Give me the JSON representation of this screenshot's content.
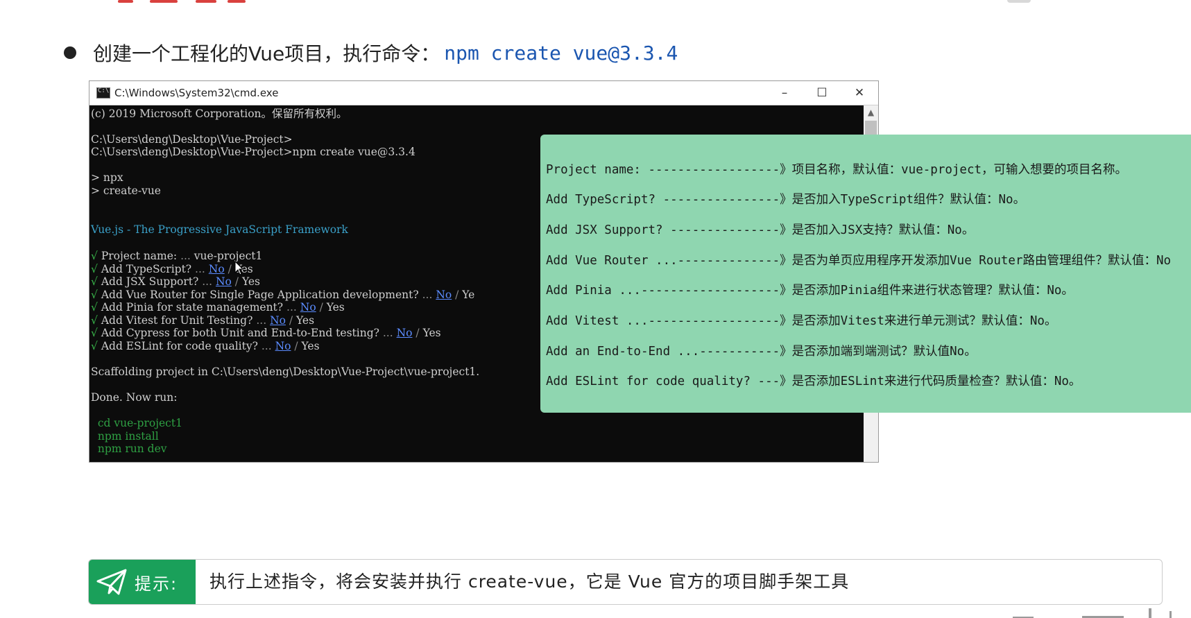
{
  "slide": {
    "bullet_text": "创建一个工程化的Vue项目，执行命令：",
    "bullet_command": "npm create vue@3.3.4"
  },
  "cmd_window": {
    "title": "C:\\Windows\\System32\\cmd.exe",
    "minimize_glyph": "–",
    "maximize_glyph": "☐",
    "close_glyph": "✕",
    "scroll_up_glyph": "▲"
  },
  "terminal": {
    "copyright": "(c) 2019 Microsoft Corporation。保留所有权利。",
    "prompt1": "C:\\Users\\deng\\Desktop\\Vue-Project>",
    "prompt2": "C:\\Users\\deng\\Desktop\\Vue-Project>npm create vue@3.3.4",
    "npx": "> npx",
    "create_vue": "> create-vue",
    "banner": "Vue.js - The Progressive JavaScript Framework",
    "check_mark": "√",
    "ellipsis": " ... ",
    "no": "No",
    "slash": " / ",
    "yes": "Yes",
    "q_project_name": "Project name:",
    "a_project_name": "vue-project1",
    "q_typescript": "Add TypeScript?",
    "q_jsx": "Add JSX Support?",
    "q_router": "Add Vue Router for Single Page Application development?",
    "router_yes_partial": "Ye",
    "q_pinia": "Add Pinia for state management?",
    "q_vitest": "Add Vitest for Unit Testing?",
    "q_cypress": "Add Cypress for both Unit and End-to-End testing?",
    "q_eslint": "Add ESLint for code quality?",
    "scaffolding": "Scaffolding project in C:\\Users\\deng\\Desktop\\Vue-Project\\vue-project1.",
    "done": "Done. Now run:",
    "cmd_cd": "  cd vue-project1",
    "cmd_install": "  npm install",
    "cmd_dev": "  npm run dev"
  },
  "explanations": [
    "Project name: ------------------》项目名称，默认值：vue-project，可输入想要的项目名称。",
    "Add TypeScript? ----------------》是否加入TypeScript组件？默认值：No。",
    "Add JSX Support? ---------------》是否加入JSX支持？默认值：No。",
    "Add Vue Router ...--------------》是否为单页应用程序开发添加Vue Router路由管理组件？默认值：No",
    "Add Pinia ...-------------------》是否添加Pinia组件来进行状态管理？默认值：No。",
    "Add Vitest ...------------------》是否添加Vitest来进行单元测试？默认值：No。",
    "Add an End-to-End ...-----------》是否添加端到端测试？默认值No。",
    "Add ESLint for code quality? ---》是否添加ESLint来进行代码质量检查？默认值：No。"
  ],
  "tip": {
    "label": "提示:",
    "text": "执行上述指令，将会安装并执行 create-vue，它是 Vue 官方的项目脚手架工具"
  },
  "colors": {
    "accent_red": "#d9413e",
    "command_blue": "#1b56b0",
    "panel_green": "#8fd6b0",
    "tip_green": "#1aa05a",
    "terminal_bg": "#0c0c0c"
  }
}
